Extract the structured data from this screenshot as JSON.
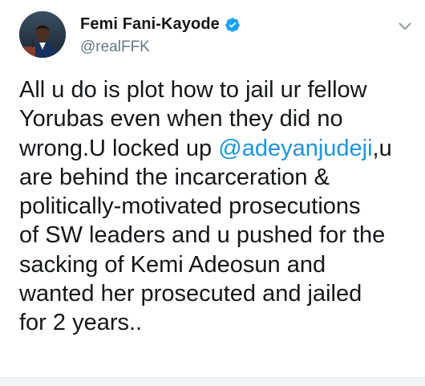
{
  "tweet": {
    "author": {
      "display_name": "Femi Fani-Kayode",
      "handle": "@realFFK",
      "verified": true,
      "avatar_icon": "profile-photo"
    },
    "menu_icon": "chevron-down-icon",
    "text_lines": [
      {
        "before": "All u do is plot how to jail ur fellow",
        "mention": "",
        "after": ""
      },
      {
        "before": "Yorubas even when they did no",
        "mention": "",
        "after": ""
      },
      {
        "before": "wrong.U locked up ",
        "mention": "@adeyanjudeji",
        "after": ",u"
      },
      {
        "before": "are behind the incarceration &",
        "mention": "",
        "after": ""
      },
      {
        "before": "politically-motivated prosecutions",
        "mention": "",
        "after": ""
      },
      {
        "before": "of SW leaders and u pushed for the",
        "mention": "",
        "after": ""
      },
      {
        "before": "sacking of Kemi Adeosun and",
        "mention": "",
        "after": ""
      },
      {
        "before": "wanted her prosecuted and jailed",
        "mention": "",
        "after": ""
      },
      {
        "before": "for 2 years..",
        "mention": "",
        "after": ""
      }
    ]
  },
  "colors": {
    "text": "#14171a",
    "secondary": "#657786",
    "link": "#1b95e0",
    "verified_badge": "#1da1f2"
  }
}
